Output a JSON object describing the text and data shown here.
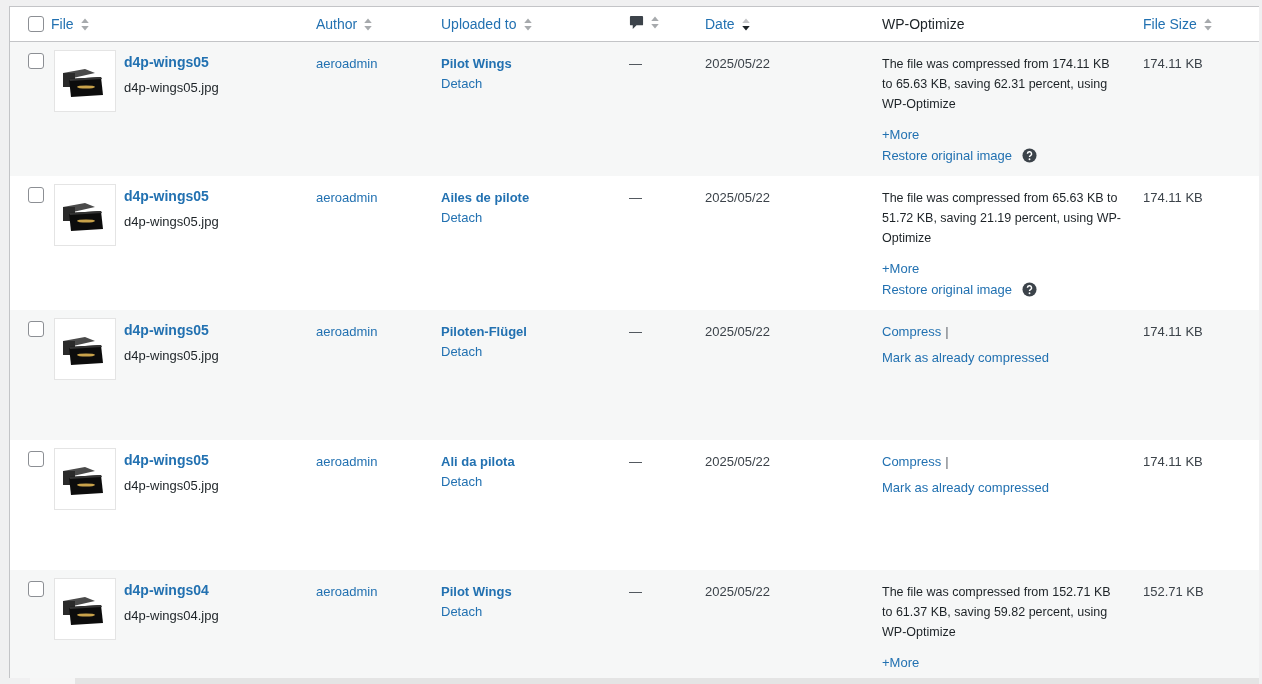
{
  "header": {
    "select_all": {
      "checked": false
    },
    "columns": [
      {
        "label": "File",
        "sortable": true,
        "sorted": false
      },
      {
        "label": "Author",
        "sortable": true,
        "sorted": false
      },
      {
        "label": "Uploaded to",
        "sortable": true,
        "sorted": false
      },
      {
        "kind": "icon",
        "sortable": true,
        "sorted": false
      },
      {
        "label": "Date",
        "sortable": true,
        "sorted": true
      },
      {
        "label": "WP-Optimize",
        "sortable": false
      },
      {
        "label": "File Size",
        "sortable": true,
        "sorted": false
      }
    ]
  },
  "rows": [
    {
      "checked": false,
      "title": "d4p-wings05",
      "filename": "d4p-wings05.jpg",
      "author": "aeroadmin",
      "uploaded_to": "Pilot Wings",
      "detach": "Detach",
      "comments": "—",
      "date": "2025/05/22",
      "wpo": {
        "kind": "compressed",
        "message": "The file was compressed from 174.11 KB to 65.63 KB, saving 62.31 percent, using WP-Optimize",
        "more": "+More",
        "restore": "Restore original image"
      },
      "size": "174.11 KB"
    },
    {
      "checked": false,
      "title": "d4p-wings05",
      "filename": "d4p-wings05.jpg",
      "author": "aeroadmin",
      "uploaded_to": "Ailes de pilote",
      "detach": "Detach",
      "comments": "—",
      "date": "2025/05/22",
      "wpo": {
        "kind": "compressed",
        "message": "The file was compressed from 65.63 KB to 51.72 KB, saving 21.19 percent, using WP-Optimize",
        "more": "+More",
        "restore": "Restore original image"
      },
      "size": "174.11 KB"
    },
    {
      "checked": false,
      "title": "d4p-wings05",
      "filename": "d4p-wings05.jpg",
      "author": "aeroadmin",
      "uploaded_to": "Piloten-Flügel",
      "detach": "Detach",
      "comments": "—",
      "date": "2025/05/22",
      "wpo": {
        "kind": "pending",
        "compress": "Compress",
        "separator": "|",
        "mark": "Mark as already compressed"
      },
      "size": "174.11 KB"
    },
    {
      "checked": false,
      "title": "d4p-wings05",
      "filename": "d4p-wings05.jpg",
      "author": "aeroadmin",
      "uploaded_to": "Ali da pilota",
      "detach": "Detach",
      "comments": "—",
      "date": "2025/05/22",
      "wpo": {
        "kind": "pending",
        "compress": "Compress",
        "separator": "|",
        "mark": "Mark as already compressed"
      },
      "size": "174.11 KB"
    },
    {
      "checked": false,
      "title": "d4p-wings04",
      "filename": "d4p-wings04.jpg",
      "author": "aeroadmin",
      "uploaded_to": "Pilot Wings",
      "detach": "Detach",
      "comments": "—",
      "date": "2025/05/22",
      "wpo": {
        "kind": "compressed",
        "message": "The file was compressed from 152.71 KB to 61.37 KB, saving 59.82 percent, using WP-Optimize",
        "more": "+More"
      },
      "size": "152.71 KB"
    }
  ]
}
